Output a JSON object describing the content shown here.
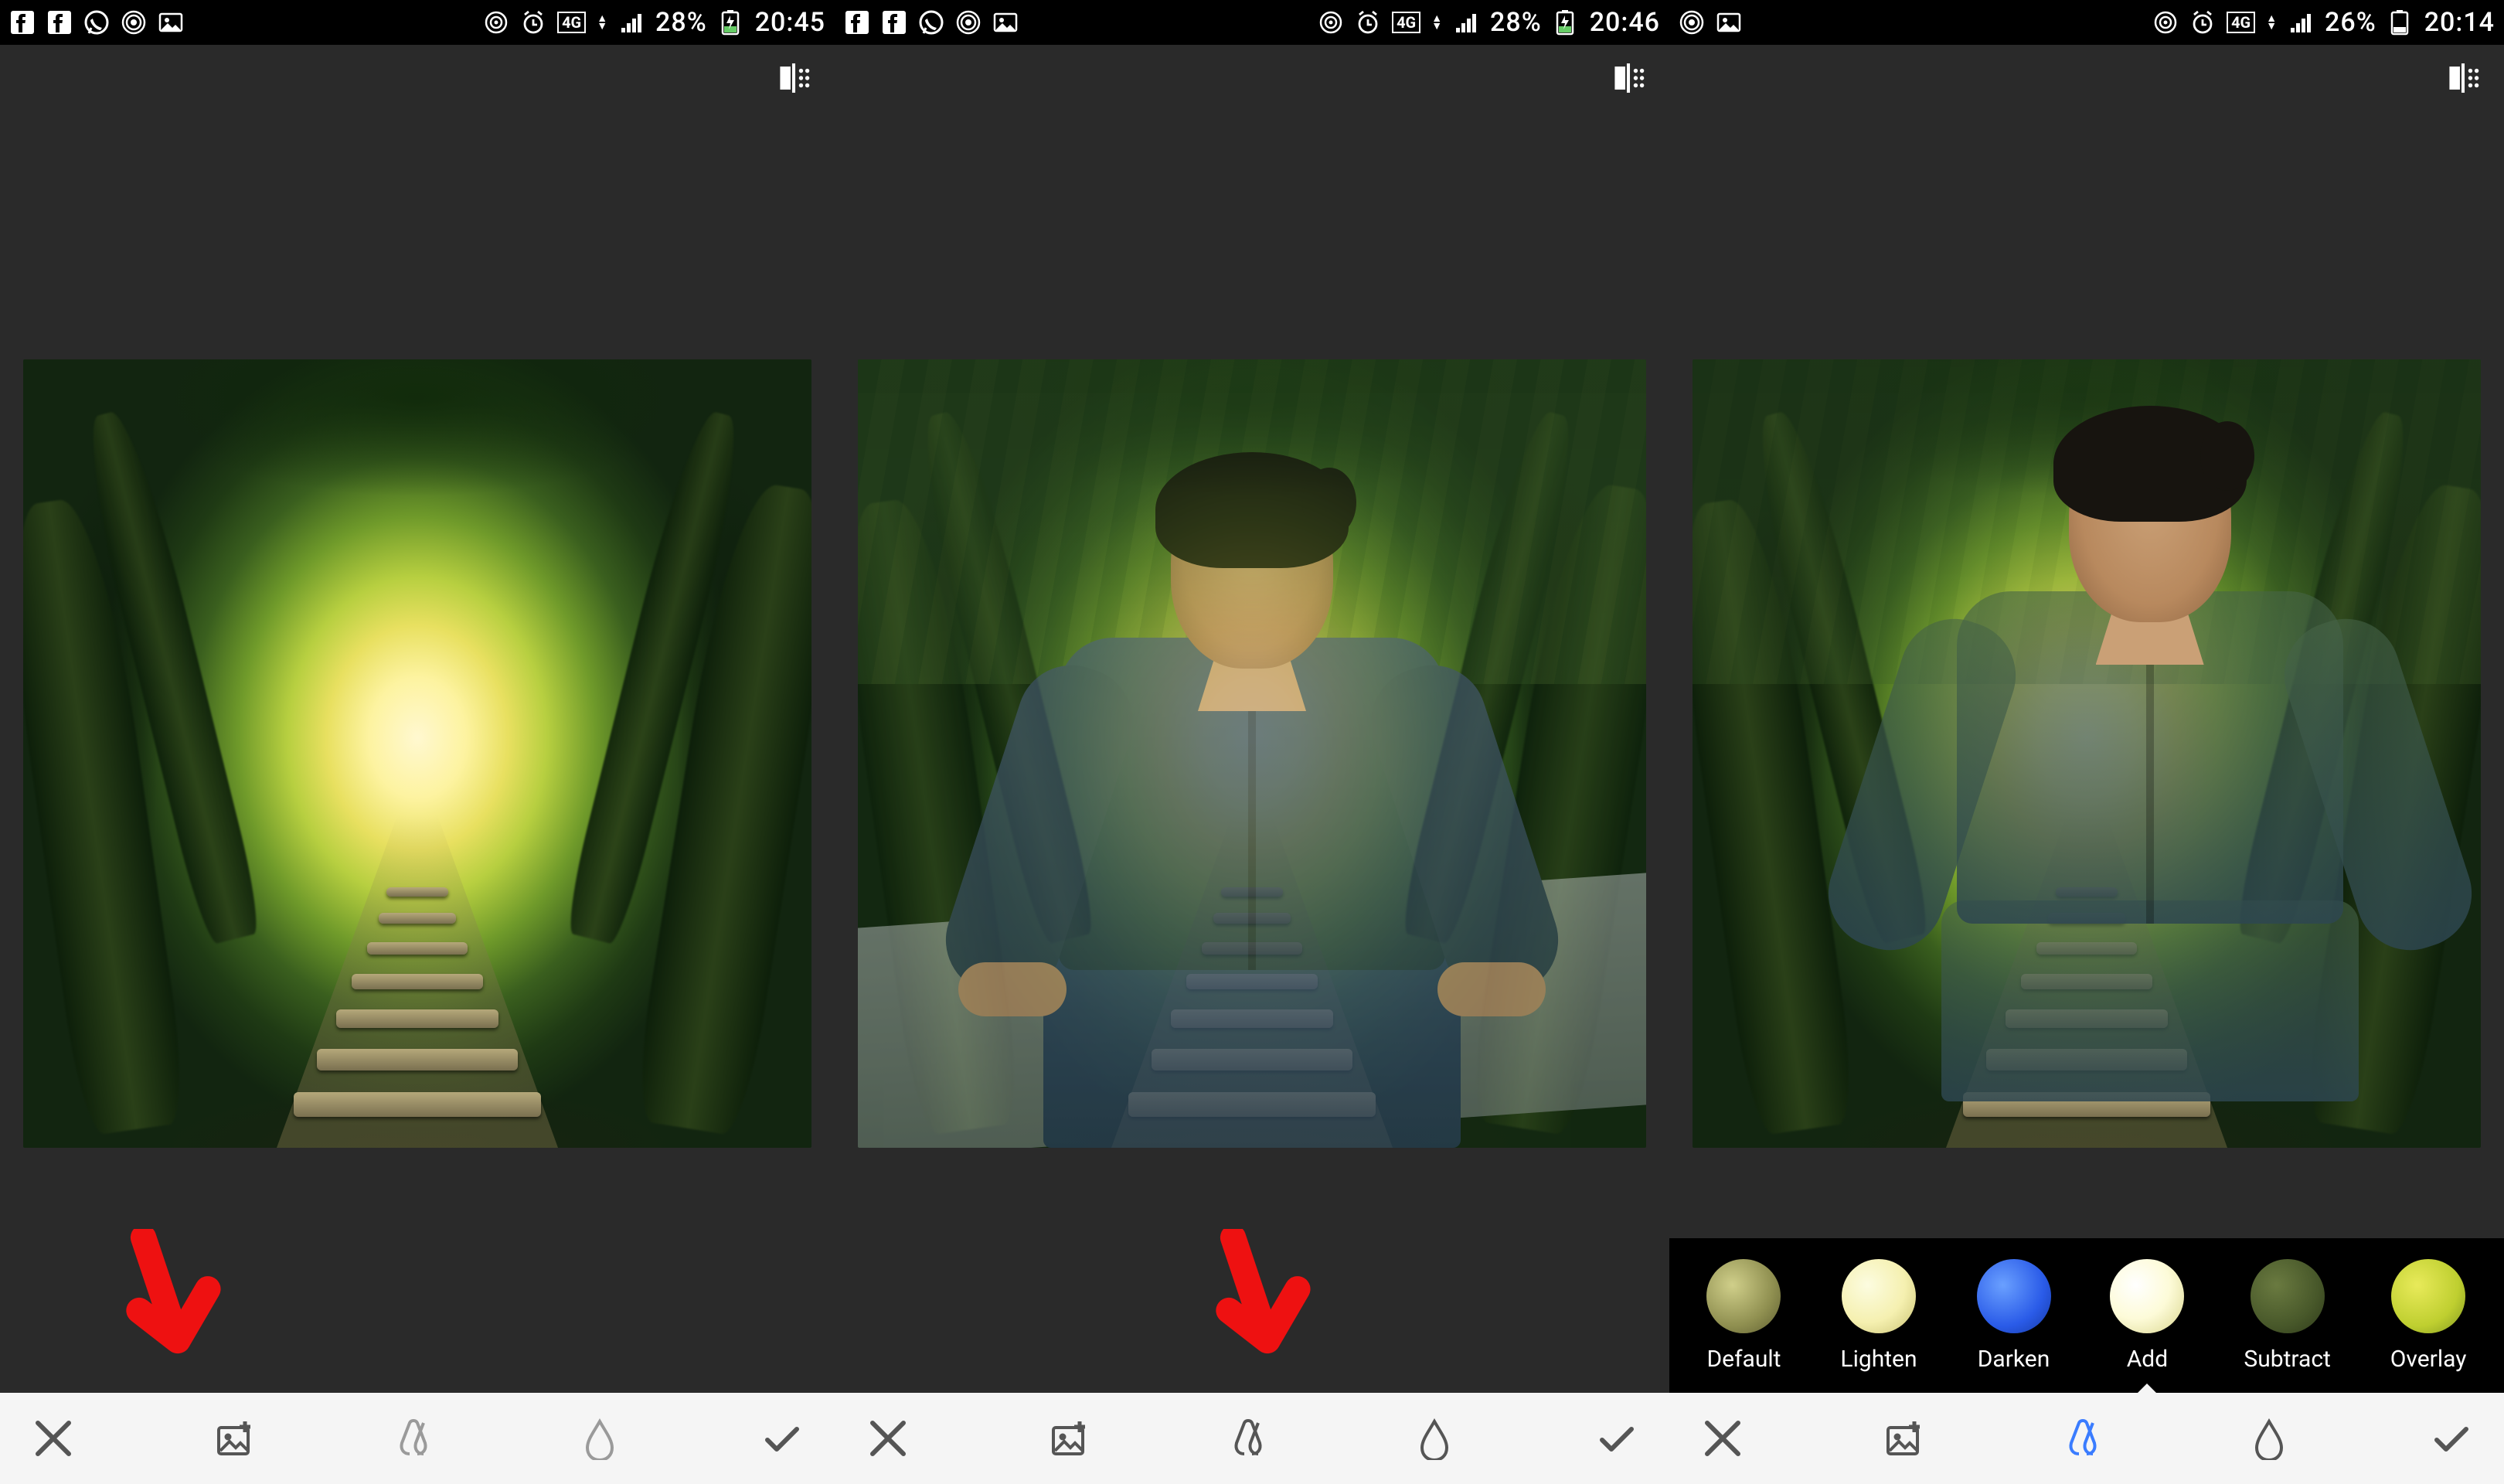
{
  "screens": [
    {
      "status": {
        "battery_pct": "28%",
        "time": "20:45",
        "network": "4G"
      },
      "arrow_target": "add-image-button",
      "toolbar": {
        "active": null
      },
      "blend_strip_visible": false
    },
    {
      "status": {
        "battery_pct": "28%",
        "time": "20:46",
        "network": "4G"
      },
      "arrow_target": "styles-button",
      "toolbar": {
        "active": null
      },
      "blend_strip_visible": false
    },
    {
      "status": {
        "battery_pct": "26%",
        "time": "20:14",
        "network": "4G"
      },
      "arrow_target": null,
      "toolbar": {
        "active": "styles-button"
      },
      "blend_strip_visible": true
    }
  ],
  "blend_modes": [
    {
      "key": "default",
      "label": "Default"
    },
    {
      "key": "lighten",
      "label": "Lighten"
    },
    {
      "key": "darken",
      "label": "Darken"
    },
    {
      "key": "add",
      "label": "Add"
    },
    {
      "key": "subtract",
      "label": "Subtract"
    },
    {
      "key": "overlay",
      "label": "Overlay"
    }
  ],
  "blend_selected": "add",
  "toolbar_buttons": [
    "cancel",
    "add-image",
    "styles",
    "opacity",
    "confirm"
  ],
  "status_icons_full": [
    "facebook",
    "facebook",
    "whatsapp",
    "hotspot",
    "gallery"
  ],
  "status_icons_short": [
    "hotspot",
    "gallery"
  ],
  "status_right_icons": [
    "cast",
    "alarm"
  ]
}
